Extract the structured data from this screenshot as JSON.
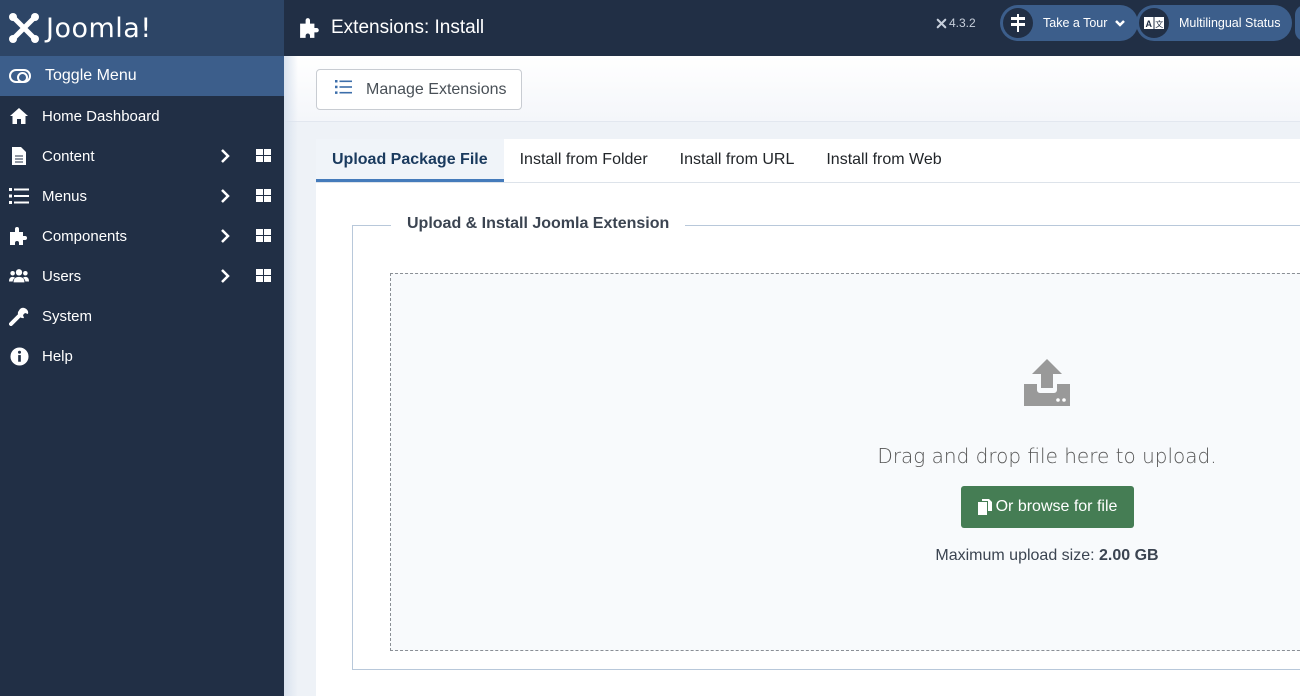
{
  "brand": {
    "name": "Joomla!"
  },
  "sidebar": {
    "toggle_label": "Toggle Menu",
    "items": [
      {
        "label": "Home Dashboard",
        "icon": "home-icon",
        "has_submenu": false
      },
      {
        "label": "Content",
        "icon": "file-icon",
        "has_submenu": true
      },
      {
        "label": "Menus",
        "icon": "list-icon",
        "has_submenu": true
      },
      {
        "label": "Components",
        "icon": "puzzle-icon",
        "has_submenu": true
      },
      {
        "label": "Users",
        "icon": "users-icon",
        "has_submenu": true
      },
      {
        "label": "System",
        "icon": "wrench-icon",
        "has_submenu": false
      },
      {
        "label": "Help",
        "icon": "info-icon",
        "has_submenu": false
      }
    ]
  },
  "header": {
    "title": "Extensions: Install",
    "version": "4.3.2",
    "tour_label": "Take a Tour",
    "multilingual_label": "Multilingual Status"
  },
  "toolbar": {
    "manage_label": "Manage Extensions"
  },
  "tabs": [
    {
      "label": "Upload Package File",
      "active": true
    },
    {
      "label": "Install from Folder",
      "active": false
    },
    {
      "label": "Install from URL",
      "active": false
    },
    {
      "label": "Install from Web",
      "active": false
    }
  ],
  "upload": {
    "legend": "Upload & Install Joomla Extension",
    "drag_text": "Drag and drop file here to upload.",
    "browse_label": "Or browse for file",
    "max_label": "Maximum upload size:",
    "max_value": "2.00 GB"
  },
  "colors": {
    "sidebar_bg": "#212f45",
    "brand_bg": "#2d4566",
    "accent": "#3c5e8b",
    "success": "#457d54"
  }
}
